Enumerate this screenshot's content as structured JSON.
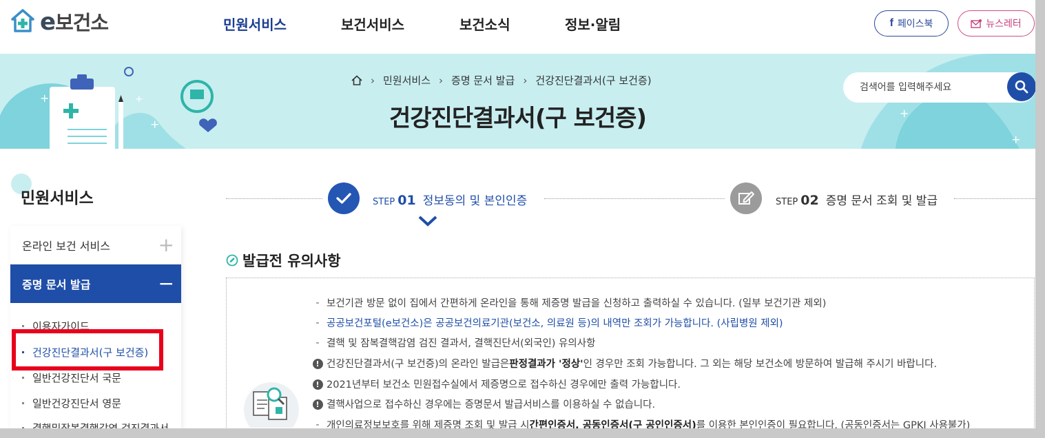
{
  "header": {
    "logo_text": "보건소",
    "logo_prefix": "e",
    "nav": [
      "민원서비스",
      "보건서비스",
      "보건소식",
      "정보·알림"
    ],
    "nav_active": "민원서비스",
    "facebook_label": "페이스북",
    "newsletter_label": "뉴스레터"
  },
  "banner": {
    "breadcrumb": [
      "민원서비스",
      "증명 문서 발급",
      "건강진단결과서(구 보건증)"
    ],
    "page_title": "건강진단결과서(구 보건증)",
    "search_placeholder": "검색어를 입력해주세요"
  },
  "sidebar": {
    "title": "민원서비스",
    "menus": [
      {
        "label": "온라인 보건 서비스",
        "sign": "+"
      },
      {
        "label": "증명 문서 발급",
        "sign": "−"
      }
    ],
    "sub_items": [
      "이용자가이드",
      "건강진단결과서(구 보건증)",
      "일반건강진단서 국문",
      "일반건강진단서 영문",
      "결핵및잠복결핵감염 검진결과서"
    ],
    "active_sub": "건강진단결과서(구 보건증)"
  },
  "steps": [
    {
      "word": "STEP",
      "num": "01",
      "text": "정보동의 및 본인인증",
      "state": "current"
    },
    {
      "word": "STEP",
      "num": "02",
      "text": "증명 문서 조회 및 발급",
      "state": "pending"
    }
  ],
  "notice": {
    "title": "발급전 유의사항",
    "lines": [
      {
        "type": "dash",
        "text": "보건기관 방문 없이 집에서 간편하게 온라인을 통해 제증명 발급을 신청하고 출력하실 수 있습니다. (일부 보건기관 제외)"
      },
      {
        "type": "dash-blue",
        "text": "공공보건포털(e보건소)은 공공보건의료기관(보건소, 의료원 등)의 내역만 조회가 가능합니다. (사립병원 제외)"
      },
      {
        "type": "dash",
        "text": "결핵 및 잠복결핵감염 검진 결과서, 결핵진단서(외국인) 유의사항"
      },
      {
        "type": "excl",
        "pre": "건강진단결과서(구 보건증)의 온라인 발급은 ",
        "bold": "판정결과가 '정상'",
        "post": "인 경우만 조회 가능합니다. 그 외는 해당 보건소에 방문하여 발급해 주시기 바랍니다."
      },
      {
        "type": "excl",
        "text": "2021년부터 보건소 민원접수실에서 제증명으로 접수하신 경우에만 출력 가능합니다."
      },
      {
        "type": "excl",
        "text": "결핵사업으로 접수하신 경우에는 증명문서 발급서비스를 이용하실 수 없습니다."
      },
      {
        "type": "dash",
        "pre": "개인의료정보보호를 위해 제증명 조회 및 발급 시 ",
        "bold": "간편인증서, 공동인증서(구 공인인증서)",
        "post": "를 이용한 본인인증이 필요합니다. (공동인증서는 GPKI 사용불가)"
      }
    ]
  },
  "colors": {
    "primary": "#1f4ea8",
    "banner_bg": "#c8eef0",
    "highlight": "#e8001c",
    "facebook": "#2b4a9c",
    "newsletter": "#c8407c"
  }
}
